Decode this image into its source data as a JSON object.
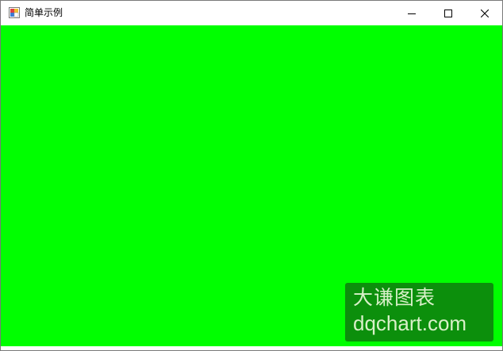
{
  "window": {
    "title": "简单示例",
    "icon": "winforms-app-icon",
    "client_background": "#00ff00",
    "controls": {
      "minimize_icon": "minimize-icon",
      "maximize_icon": "maximize-icon",
      "close_icon": "close-icon"
    }
  },
  "watermark": {
    "line1": "大谦图表",
    "line2": "dqchart.com",
    "background": "#0c8f0c",
    "text_color": "#d8f0c8"
  }
}
